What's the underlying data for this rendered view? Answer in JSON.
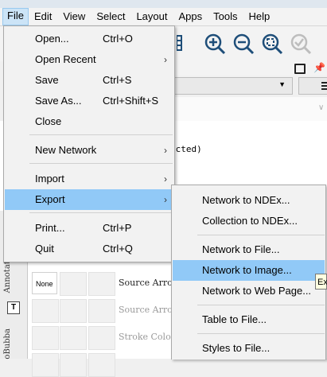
{
  "menubar": {
    "items": [
      "File",
      "Edit",
      "View",
      "Select",
      "Layout",
      "Apps",
      "Tools",
      "Help"
    ]
  },
  "toolbar": {
    "icons": [
      "zoom-in-icon",
      "zoom-out-icon",
      "zoom-fit-icon",
      "zoom-selected-icon"
    ]
  },
  "background": {
    "selected_text": "ected)"
  },
  "file_menu": {
    "items": [
      {
        "label": "Open...",
        "shortcut": "Ctrl+O"
      },
      {
        "label": "Open Recent",
        "submenu": "›"
      },
      {
        "label": "Save",
        "shortcut": "Ctrl+S"
      },
      {
        "label": "Save As...",
        "shortcut": "Ctrl+Shift+S"
      },
      {
        "label": "Close"
      },
      {
        "label": "New Network",
        "submenu": "›"
      },
      {
        "label": "Import",
        "submenu": "›"
      },
      {
        "label": "Export",
        "submenu": "›"
      },
      {
        "label": "Print...",
        "shortcut": "Ctrl+P"
      },
      {
        "label": "Quit",
        "shortcut": "Ctrl+Q"
      }
    ]
  },
  "export_menu": {
    "items": [
      {
        "label": "Network to NDEx..."
      },
      {
        "label": "Collection to NDEx..."
      },
      {
        "label": "Network to File..."
      },
      {
        "label": "Network to Image..."
      },
      {
        "label": "Network to Web Page..."
      },
      {
        "label": "Table to File..."
      },
      {
        "label": "Styles to File..."
      }
    ]
  },
  "tooltip": {
    "text": "Ex"
  },
  "side_tabs": {
    "annotation": "Annotati",
    "bubba": "oBubba",
    "text_icon": "T"
  },
  "style_rows": [
    {
      "default": "None",
      "label": "Source Arro"
    },
    {
      "default": "",
      "label": "Source Arro"
    },
    {
      "default": "",
      "label": "Stroke Colo"
    }
  ],
  "colors": {
    "menu_highlight": "#91c9f7",
    "active_menubar": "#cce4f7",
    "toolbar_icon": "#1e4e79"
  }
}
